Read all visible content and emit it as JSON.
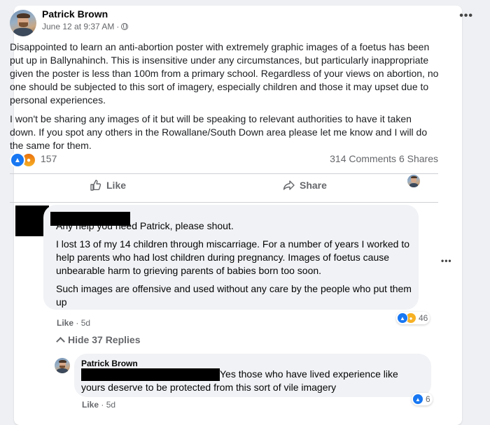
{
  "post": {
    "author": "Patrick Brown",
    "timestamp": "June 12 at 9:37 AM",
    "separator": "·",
    "more": "•••",
    "paragraphs": [
      "Disappointed to learn an anti-abortion poster with extremely graphic images of a foetus has been put up in Ballynahinch. This is insensitive under any circumstances, but particularly inappropriate given the poster is less than 100m from a primary school. Regardless of your views on abortion, no one should be subjected to this sort of imagery, especially children and those it may upset due to personal experiences.",
      "I won't be sharing any images of it but will be speaking to relevant authorities to have it taken down. If you spot any others in the Rowallane/South Down area please let me know and I will do the same for them."
    ],
    "reaction_count": "157",
    "comments_count": "314 Comments",
    "shares_count": "6 Shares"
  },
  "actions": {
    "like": "Like",
    "share": "Share"
  },
  "comments": {
    "first": {
      "paragraphs": [
        "Any help you need Patrick, please shout.",
        "I lost 13 of my 14 children through miscarriage. For a number of years I worked to help parents who had lost children during pregnancy. Images of foetus cause unbearable harm to grieving parents of babies born too soon.",
        "Such images are offensive and used without any care by the people who put them up"
      ],
      "like_label": "Like",
      "age": "5d",
      "reaction_count": "46"
    },
    "hide_replies": "Hide 37 Replies",
    "reply": {
      "author": "Patrick Brown",
      "text": "Yes those who have lived experience like yours deserve to be protected from this sort of vile imagery",
      "like_label": "Like",
      "age": "5d",
      "reaction_count": "6"
    }
  },
  "colors": {
    "like_blue": "#1877f2",
    "meta_gray": "#65676b",
    "bubble": "#f0f2f5"
  }
}
